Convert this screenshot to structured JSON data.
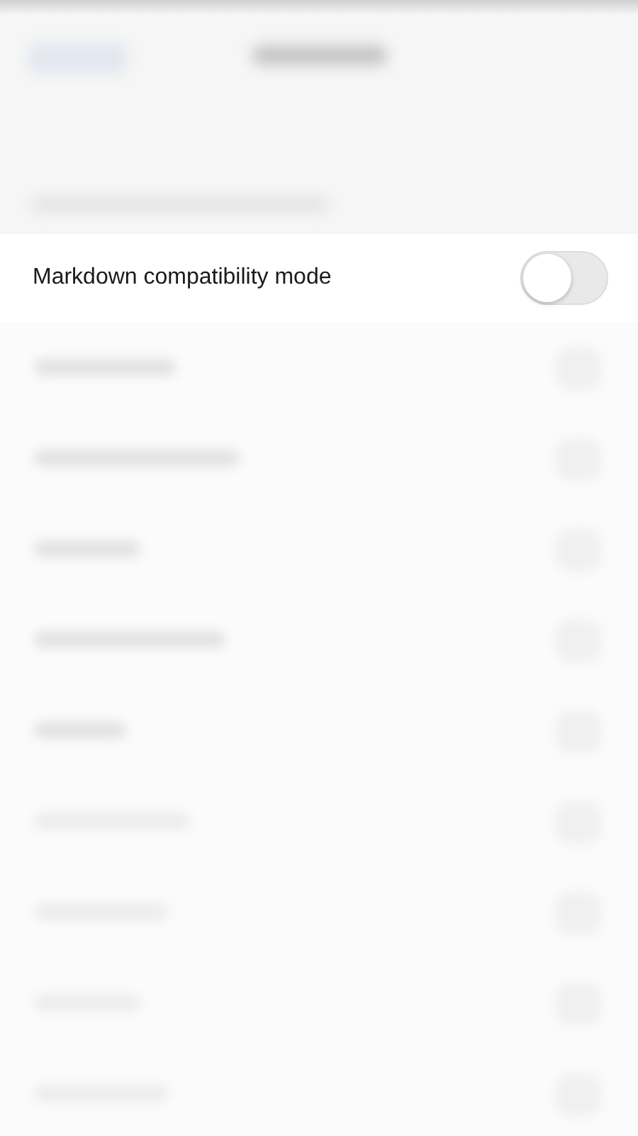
{
  "setting": {
    "label": "Markdown compatibility mode",
    "on": false
  }
}
